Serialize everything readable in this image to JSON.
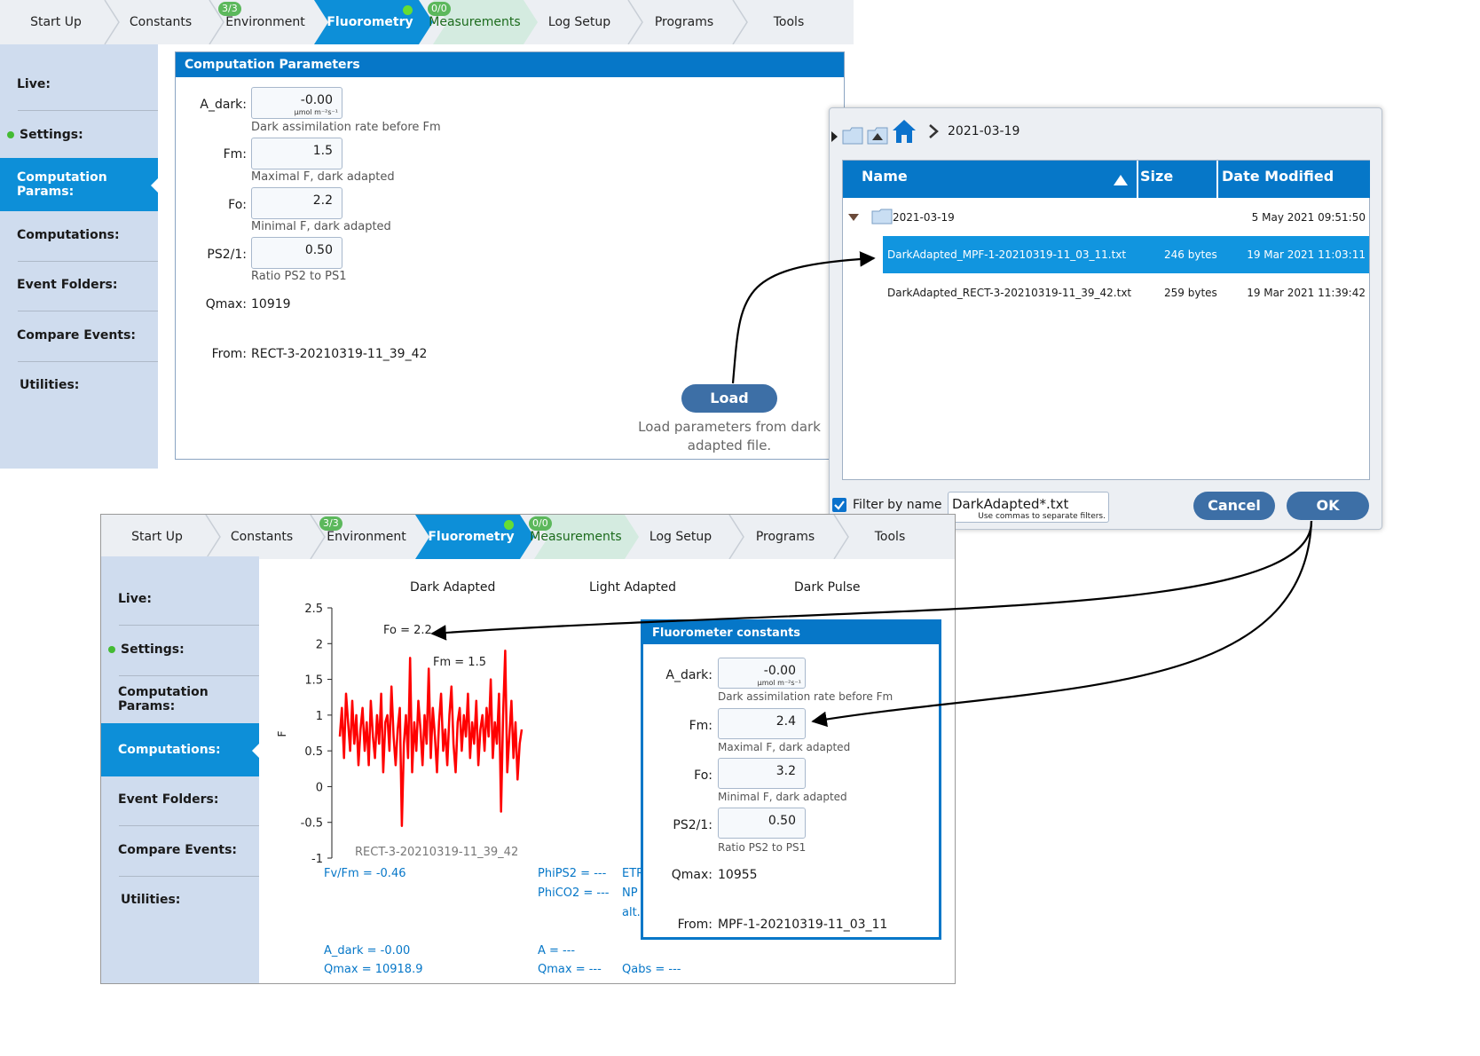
{
  "tabs": [
    {
      "label": "Start Up"
    },
    {
      "label": "Constants"
    },
    {
      "label": "Environment",
      "badge": "3/3"
    },
    {
      "label": "Fluorometry",
      "active": true
    },
    {
      "label": "Measurements",
      "badge": "0/0"
    },
    {
      "label": "Log Setup"
    },
    {
      "label": "Programs"
    },
    {
      "label": "Tools"
    }
  ],
  "sidebar": {
    "items": [
      {
        "label": "Live:"
      },
      {
        "label": "Settings:"
      },
      {
        "label": "Computation Params:"
      },
      {
        "label": "Computations:"
      },
      {
        "label": "Event Folders:"
      },
      {
        "label": "Compare Events:"
      },
      {
        "label": "Utilities:"
      }
    ]
  },
  "params_panel": {
    "title": "Computation Parameters",
    "fields": [
      {
        "label": "A_dark:",
        "value": "-0.00",
        "unit": "µmol m⁻²s⁻¹",
        "desc": "Dark assimilation rate before Fm"
      },
      {
        "label": "Fm:",
        "value": "1.5",
        "desc": "Maximal F, dark adapted"
      },
      {
        "label": "Fo:",
        "value": "2.2",
        "desc": "Minimal F, dark adapted"
      },
      {
        "label": "PS2/1:",
        "value": "0.50",
        "desc": "Ratio PS2 to PS1"
      }
    ],
    "qmax_label": "Qmax:",
    "qmax_value": "10919",
    "from_label": "From:",
    "from_value": "RECT-3-20210319-11_39_42",
    "load_label": "Load",
    "load_desc_line1": "Load parameters from dark",
    "load_desc_line2": "adapted file."
  },
  "file_dialog": {
    "path": "2021-03-19",
    "columns": {
      "name": "Name",
      "size": "Size",
      "date": "Date Modified"
    },
    "folder": {
      "name": "2021-03-19",
      "date": "5 May 2021 09:51:50"
    },
    "files": [
      {
        "name": "DarkAdapted_MPF-1-20210319-11_03_11.txt",
        "size": "246 bytes",
        "date": "19 Mar 2021 11:03:11",
        "selected": true
      },
      {
        "name": "DarkAdapted_RECT-3-20210319-11_39_42.txt",
        "size": "259 bytes",
        "date": "19 Mar 2021 11:39:42",
        "selected": false
      }
    ],
    "filter_label": "Filter by name",
    "filter_value": "DarkAdapted*.txt",
    "filter_hint": "Use commas to separate filters.",
    "cancel_label": "Cancel",
    "ok_label": "OK",
    "colors": {
      "header": "#0677c8",
      "selected": "#1195df"
    }
  },
  "computations": {
    "column_heads": [
      "Dark Adapted",
      "Light Adapted",
      "Dark Pulse"
    ],
    "chart_caption": "RECT-3-20210319-11_39_42",
    "annotations": {
      "fo": "Fo = 2.2",
      "fm": "Fm = 1.5"
    },
    "stats": {
      "fvfm": "Fv/Fm = -0.46",
      "phips2": "PhiPS2 = ---",
      "phico2": "PhiCO2 = ---",
      "etr": "ETR",
      "npq": "NP",
      "alt": "alt.",
      "a_dark": "A_dark = -0.00",
      "qmax": "Qmax = 10918.9",
      "a": "A = ---",
      "qmax2": "Qmax = ---",
      "qabs": "Qabs = ---"
    }
  },
  "constants_panel": {
    "title": "Fluorometer constants",
    "fields": [
      {
        "label": "A_dark:",
        "value": "-0.00",
        "unit": "µmol m⁻²s⁻¹",
        "desc": "Dark assimilation rate before Fm"
      },
      {
        "label": "Fm:",
        "value": "2.4",
        "desc": "Maximal F, dark adapted"
      },
      {
        "label": "Fo:",
        "value": "3.2",
        "desc": "Minimal F, dark adapted"
      },
      {
        "label": "PS2/1:",
        "value": "0.50",
        "desc": "Ratio PS2 to PS1"
      }
    ],
    "qmax_label": "Qmax:",
    "qmax_value": "10955",
    "from_label": "From:",
    "from_value": "MPF-1-20210319-11_03_11"
  },
  "chart_data": {
    "type": "line",
    "title": "",
    "xlabel": "",
    "ylabel": "F",
    "ylim": [
      -1,
      2.5
    ],
    "yticks": [
      "2.5",
      "2",
      "1.5",
      "1",
      "0.5",
      "0",
      "-0.5",
      "-1"
    ],
    "grid": false,
    "series": [
      {
        "color": "#ff0000",
        "values": [
          0.7,
          1.1,
          0.4,
          1.3,
          0.9,
          0.5,
          1.2,
          0.6,
          1.0,
          0.3,
          0.8,
          1.1,
          0.5,
          0.9,
          0.3,
          1.2,
          0.7,
          0.4,
          1.0,
          0.6,
          1.3,
          0.2,
          0.9,
          1.0,
          0.5,
          1.4,
          0.7,
          0.3,
          0.8,
          1.1,
          -0.55,
          0.6,
          1.0,
          0.4,
          1.8,
          0.2,
          0.9,
          0.5,
          1.2,
          0.8,
          0.3,
          1.0,
          0.6,
          1.65,
          0.4,
          1.1,
          0.7,
          0.2,
          0.9,
          1.3,
          0.5,
          0.8,
          0.3,
          1.0,
          1.4,
          0.6,
          0.2,
          0.9,
          1.1,
          0.5,
          1.0,
          0.7,
          1.3,
          0.4,
          0.9,
          0.6,
          1.2,
          0.3,
          0.8,
          1.0,
          0.5,
          1.1,
          0.7,
          1.5,
          0.4,
          0.9,
          0.6,
          1.3,
          -0.35,
          1.0,
          1.9,
          0.2,
          0.7,
          1.2,
          0.4,
          0.9,
          0.1,
          0.6,
          0.8
        ]
      }
    ]
  }
}
